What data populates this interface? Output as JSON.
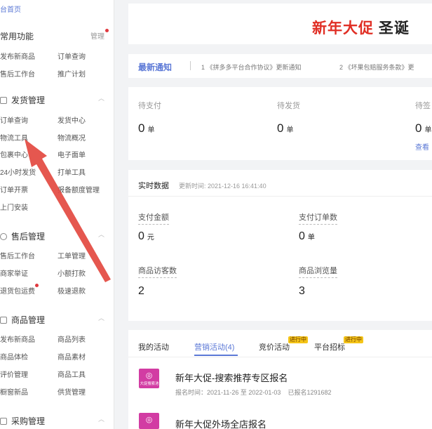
{
  "sidebar": {
    "home": "台首页",
    "common": {
      "title": "常用功能",
      "manage": "管理",
      "links": [
        "发布新商品",
        "订单查询",
        "售后工作台",
        "推广计划"
      ]
    },
    "shipping": {
      "title": "发货管理",
      "links": [
        "订单查询",
        "发货中心",
        "物流工具",
        "物流概况",
        "包裹中心",
        "电子面单",
        "24小时发货",
        "打单工具",
        "订单开票",
        "报备额度管理",
        "上门安装"
      ]
    },
    "aftersale": {
      "title": "售后管理",
      "links": [
        "售后工作台",
        "工单管理",
        "商家举证",
        "小额打款",
        "退货包运费",
        "极速退款"
      ]
    },
    "goods": {
      "title": "商品管理",
      "links": [
        "发布新商品",
        "商品列表",
        "商品体检",
        "商品素材",
        "评价管理",
        "商品工具",
        "橱窗新品",
        "供货管理"
      ]
    },
    "purchase": {
      "title": "采购管理"
    }
  },
  "banner": {
    "text_red": "新年大促",
    "text_dark": "圣诞"
  },
  "notice": {
    "label": "最新通知",
    "items": [
      "1  《拼多多平台合作协议》更新通知",
      "2  《坏果包赔服务条款》更"
    ]
  },
  "orders": {
    "items": [
      {
        "label": "待支付",
        "value": "0",
        "unit": "单"
      },
      {
        "label": "待发货",
        "value": "0",
        "unit": "单"
      },
      {
        "label": "待签",
        "value": "0",
        "unit": "单"
      }
    ],
    "view": "查看"
  },
  "realtime": {
    "title": "实时数据",
    "updated": "更新时间: 2021-12-16 16:41:40",
    "metrics": [
      {
        "label": "支付金额",
        "value": "0",
        "unit": "元"
      },
      {
        "label": "支付订单数",
        "value": "0",
        "unit": "单"
      },
      {
        "label": "商品访客数",
        "value": "2",
        "unit": ""
      },
      {
        "label": "商品浏览量",
        "value": "3",
        "unit": ""
      }
    ]
  },
  "activity": {
    "tabs": [
      "我的活动",
      "营销活动(4)",
      "竞价活动",
      "平台招标"
    ],
    "badges": [
      "进行中",
      "进行中"
    ],
    "items": [
      {
        "icon_caption": "大促搜索池",
        "title": "新年大促-搜索推荐专区报名",
        "time": "报名时间：2021-11-26 至 2022-01-03",
        "count": "已报名1291682"
      },
      {
        "icon_caption": "",
        "title": "新年大促外场全店报名"
      }
    ]
  },
  "colors": {
    "accent": "#5b78d6",
    "brand_red": "#e02e24",
    "activity_icon": "#d23ca3",
    "arrow": "#e2453c"
  }
}
